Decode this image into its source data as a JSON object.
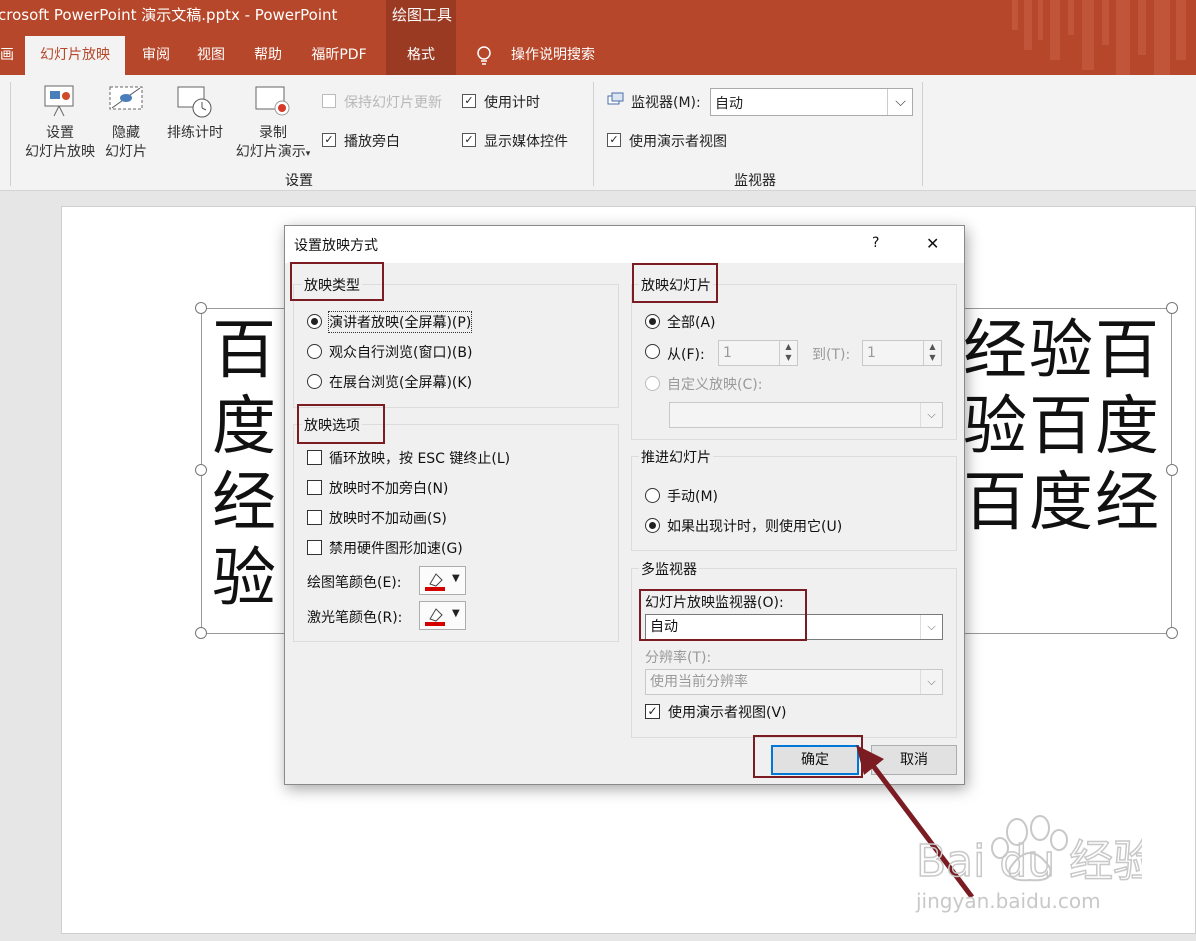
{
  "window": {
    "title": "crosoft PowerPoint 演示文稿.pptx  -  PowerPoint",
    "context_group": "绘图工具"
  },
  "tabs": {
    "partial": "画",
    "slideshow": "幻灯片放映",
    "review": "审阅",
    "view": "视图",
    "help": "帮助",
    "foxit": "福昕PDF",
    "format": "格式",
    "tell_me": "操作说明搜索"
  },
  "ribbon": {
    "setup_slideshow": [
      "设置",
      "幻灯片放映"
    ],
    "hide_slide": [
      "隐藏",
      "幻灯片"
    ],
    "rehearse": "排练计时",
    "record": [
      "录制",
      "幻灯片演示"
    ],
    "keep_updated": "保持幻灯片更新",
    "play_narrations": "播放旁白",
    "use_timings": "使用计时",
    "show_media_controls": "显示媒体控件",
    "group_setup": "设置",
    "monitor_label": "监视器(M):",
    "monitor_value": "自动",
    "use_presenter_view": "使用演示者视图",
    "group_monitors": "监视器"
  },
  "slide": {
    "left_lines": [
      "百",
      "度",
      "经",
      "验"
    ],
    "right_lines": [
      "经验百",
      "验百度",
      "百度经"
    ]
  },
  "dialog": {
    "title": "设置放映方式",
    "help": "?",
    "close": "✕",
    "show_type": {
      "label": "放映类型",
      "options": [
        "演讲者放映(全屏幕)(P)",
        "观众自行浏览(窗口)(B)",
        "在展台浏览(全屏幕)(K)"
      ],
      "selected": 0
    },
    "show_options": {
      "label": "放映选项",
      "checks": [
        "循环放映，按 ESC 键终止(L)",
        "放映时不加旁白(N)",
        "放映时不加动画(S)",
        "禁用硬件图形加速(G)"
      ],
      "pen_color": "绘图笔颜色(E):",
      "laser_color": "激光笔颜色(R):"
    },
    "show_slides": {
      "label": "放映幻灯片",
      "all": "全部(A)",
      "from": "从(F):",
      "from_value": "1",
      "to": "到(T):",
      "to_value": "1",
      "custom": "自定义放映(C):"
    },
    "advance": {
      "label": "推进幻灯片",
      "manual": "手动(M)",
      "use_timings": "如果出现计时，则使用它(U)"
    },
    "multi_monitor": {
      "label": "多监视器",
      "monitor_label": "幻灯片放映监视器(O):",
      "monitor_value": "自动",
      "resolution_label": "分辨率(T):",
      "resolution_value": "使用当前分辨率",
      "presenter_view": "使用演示者视图(V)"
    },
    "ok": "确定",
    "cancel": "取消"
  },
  "watermark": {
    "logo": "Bai du 经验",
    "url": "jingyan.baidu.com"
  },
  "colors": {
    "accent": "#b7472a",
    "annotation": "#7b1b22",
    "pen": "#d40000"
  }
}
